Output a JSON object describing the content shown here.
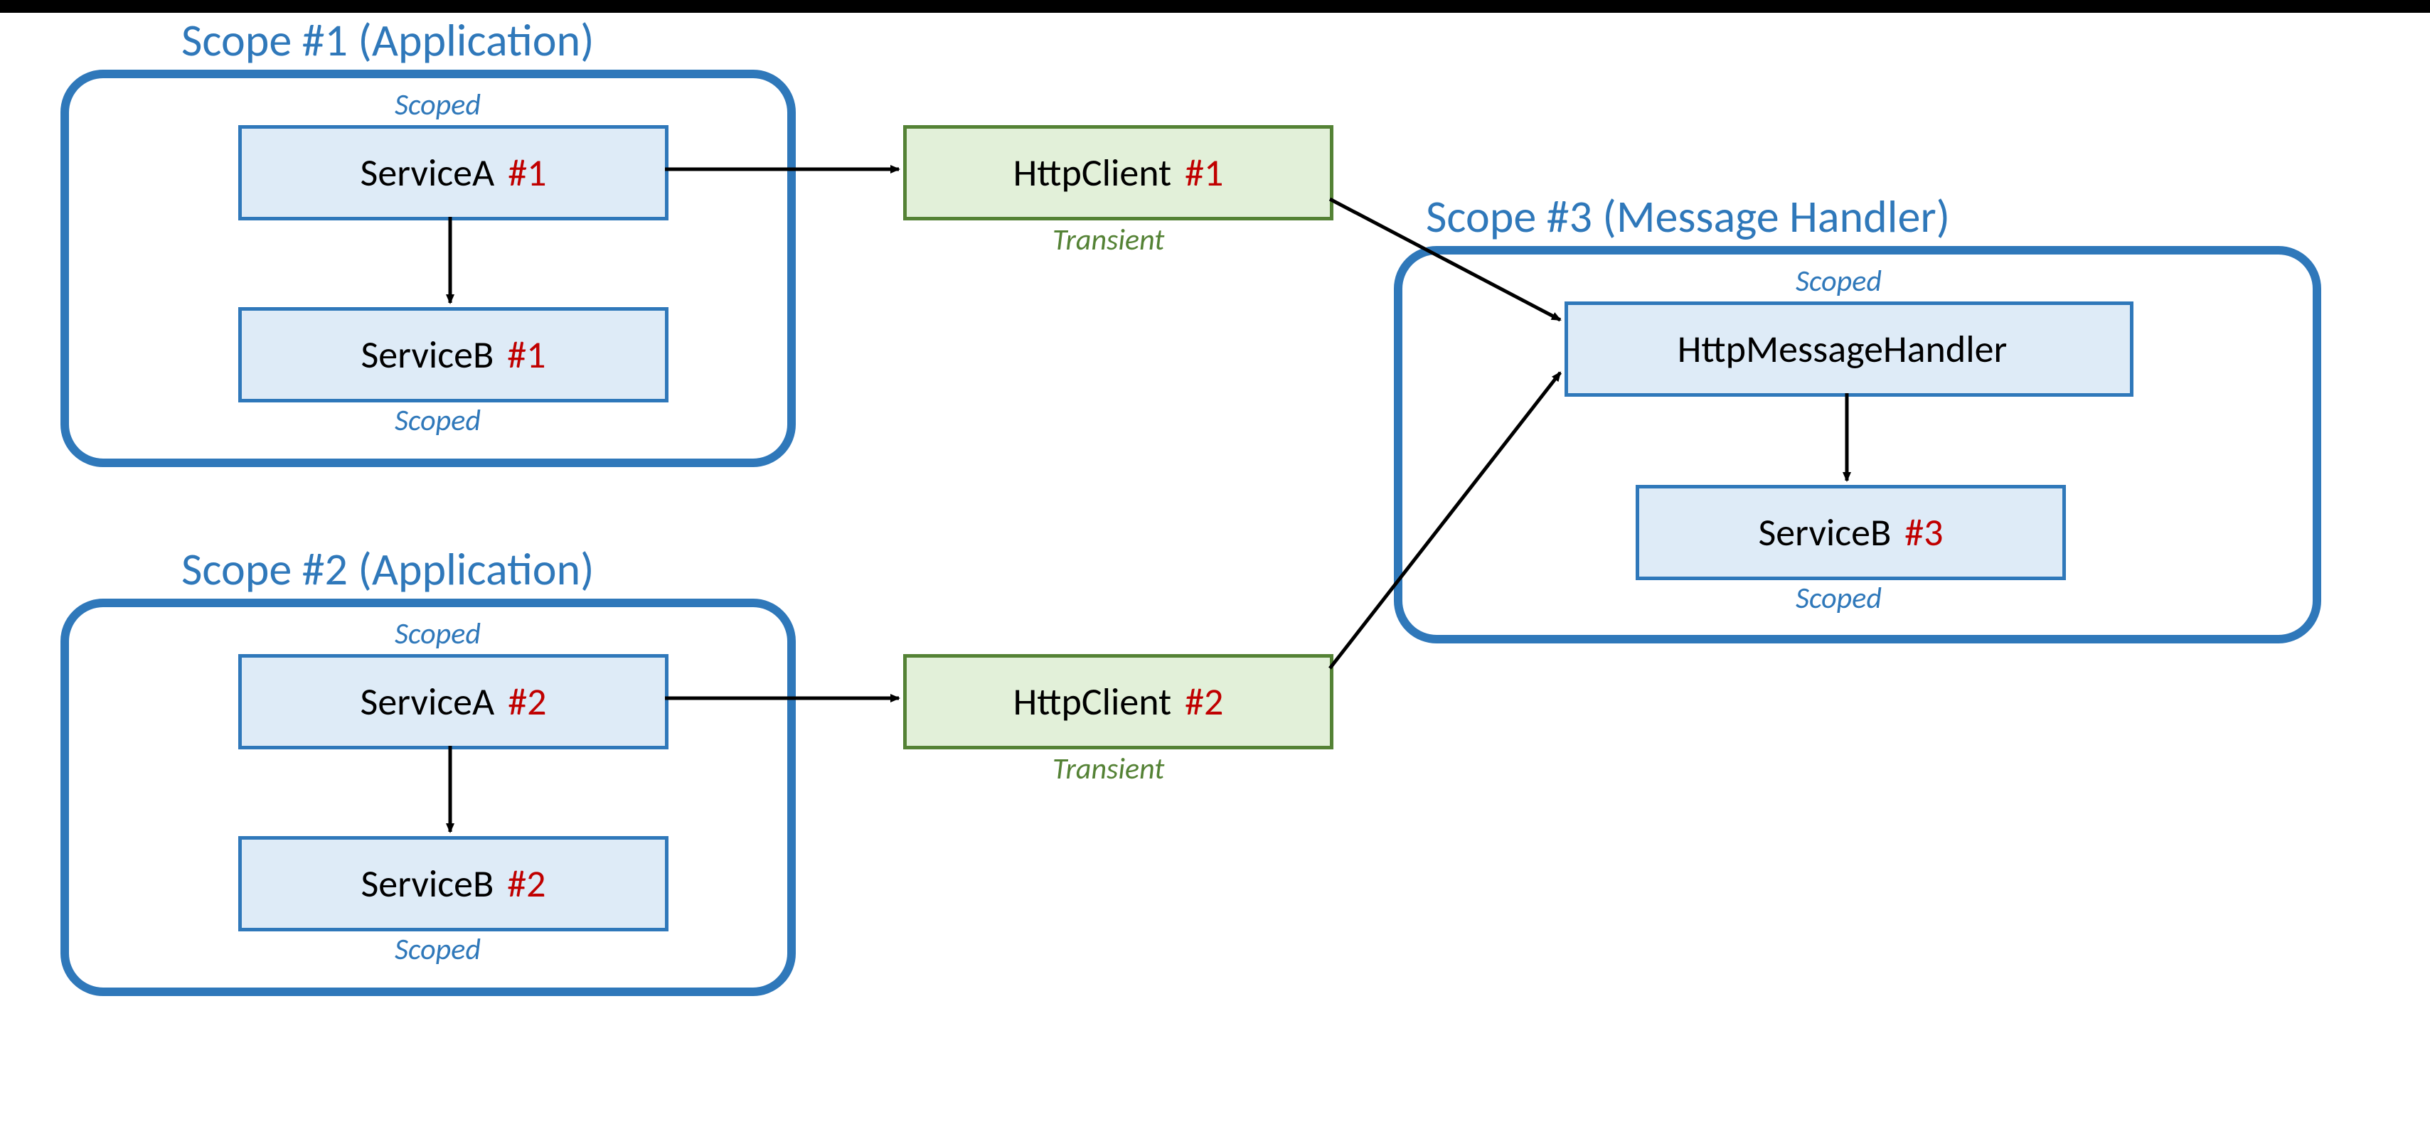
{
  "scopes": {
    "s1": {
      "title": "Scope #1 (Application)"
    },
    "s2": {
      "title": "Scope #2 (Application)"
    },
    "s3": {
      "title": "Scope #3 (Message Handler)"
    }
  },
  "lifetimes": {
    "scoped": "Scoped",
    "transient": "Transient"
  },
  "nodes": {
    "serviceA1": {
      "label": "ServiceA",
      "suffix": "#1"
    },
    "serviceB1": {
      "label": "ServiceB",
      "suffix": "#1"
    },
    "serviceA2": {
      "label": "ServiceA",
      "suffix": "#2"
    },
    "serviceB2": {
      "label": "ServiceB",
      "suffix": "#2"
    },
    "httpClient1": {
      "label": "HttpClient",
      "suffix": "#1"
    },
    "httpClient2": {
      "label": "HttpClient",
      "suffix": "#2"
    },
    "httpMessageHandler": {
      "label": "HttpMessageHandler",
      "suffix": ""
    },
    "serviceB3": {
      "label": "ServiceB",
      "suffix": "#3"
    }
  },
  "colors": {
    "scopeBorder": "#2F78BA",
    "scopedText": "#2F78BA",
    "transientText": "#548235",
    "instanceSuffix": "#C00000",
    "blueFill": "#DEEBF7",
    "greenFill": "#E2F0D9",
    "greenBorder": "#548235"
  }
}
